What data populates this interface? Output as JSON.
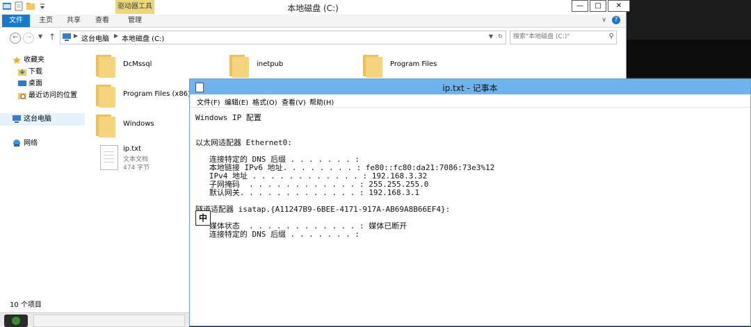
{
  "explorer": {
    "title": "本地磁盘 (C:)",
    "context_tab": "驱动器工具",
    "ribbon_tabs": [
      "文件",
      "主页",
      "共享",
      "查看",
      "管理"
    ],
    "address": {
      "crumbs": [
        "这台电脑",
        "本地磁盘 (C:)"
      ]
    },
    "search_placeholder": "搜索\"本地磁盘 (C:)\"",
    "nav": {
      "favorites": "收藏夹",
      "downloads": "下载",
      "desktop": "桌面",
      "recent": "最近访问的位置",
      "this_pc": "这台电脑",
      "network": "网络"
    },
    "files": [
      {
        "name": "DcMssql"
      },
      {
        "name": "inetpub"
      },
      {
        "name": "Program Files"
      },
      {
        "name": "Program Files (x86)"
      },
      {
        "name": "Windows"
      },
      {
        "name": "ip.txt",
        "type": "文本文档",
        "size": "474 字节"
      }
    ],
    "status": "10 个项目"
  },
  "notepad": {
    "title": "ip.txt - 记事本",
    "menu": [
      "文件(F)",
      "编辑(E)",
      "格式(O)",
      "查看(V)",
      "帮助(H)"
    ],
    "content": "Windows IP 配置\n\n\n以太网适配器 Ethernet0:\n\n   连接特定的 DNS 后缀 . . . . . . . :\n   本地链接 IPv6 地址. . . . . . . . : fe80::fc80:da21:7086:73e3%12\n   IPv4 地址 . . . . . . . . . . . . : 192.168.3.32\n   子网掩码  . . . . . . . . . . . . : 255.255.255.0\n   默认网关. . . . . . . . . . . . . : 192.168.3.1\n\n隧道适配器 isatap.{A11247B9-6BEE-4171-917A-AB69A8B66EF4}:\n\n   媒体状态  . . . . . . . . . . . . : 媒体已断开\n   连接特定的 DNS 后缀 . . . . . . . :",
    "ime": "中"
  }
}
